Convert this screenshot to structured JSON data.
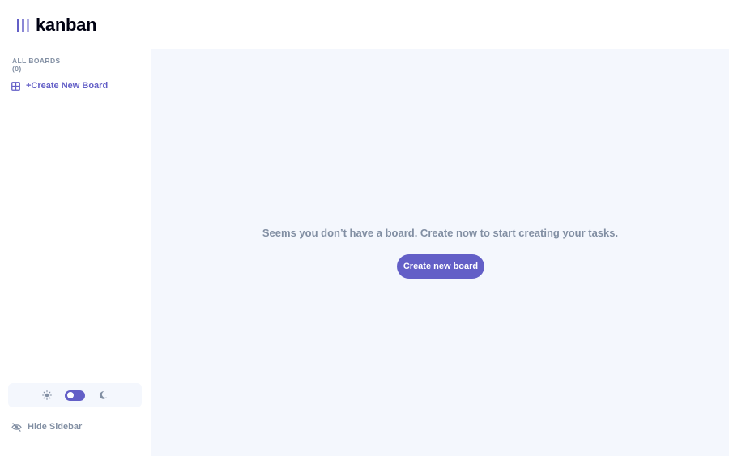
{
  "app": {
    "name": "kanban",
    "accent_color": "#635fc7",
    "logo_icon": "kanban-bars-icon"
  },
  "sidebar": {
    "all_boards_label": "ALL BOARDS",
    "board_count": "(0)",
    "boards": [],
    "create_board_label": "+Create New Board",
    "create_board_icon": "board-layout-icon",
    "theme": {
      "light_icon": "sun-icon",
      "dark_icon": "moon-icon",
      "switch_state": "light"
    },
    "hide_sidebar_label": "Hide Sidebar",
    "hide_sidebar_icon": "eye-slash-icon"
  },
  "main": {
    "empty_message": "Seems you don’t have a board. Create now to start creating your tasks.",
    "create_button_label": "Create new board"
  }
}
